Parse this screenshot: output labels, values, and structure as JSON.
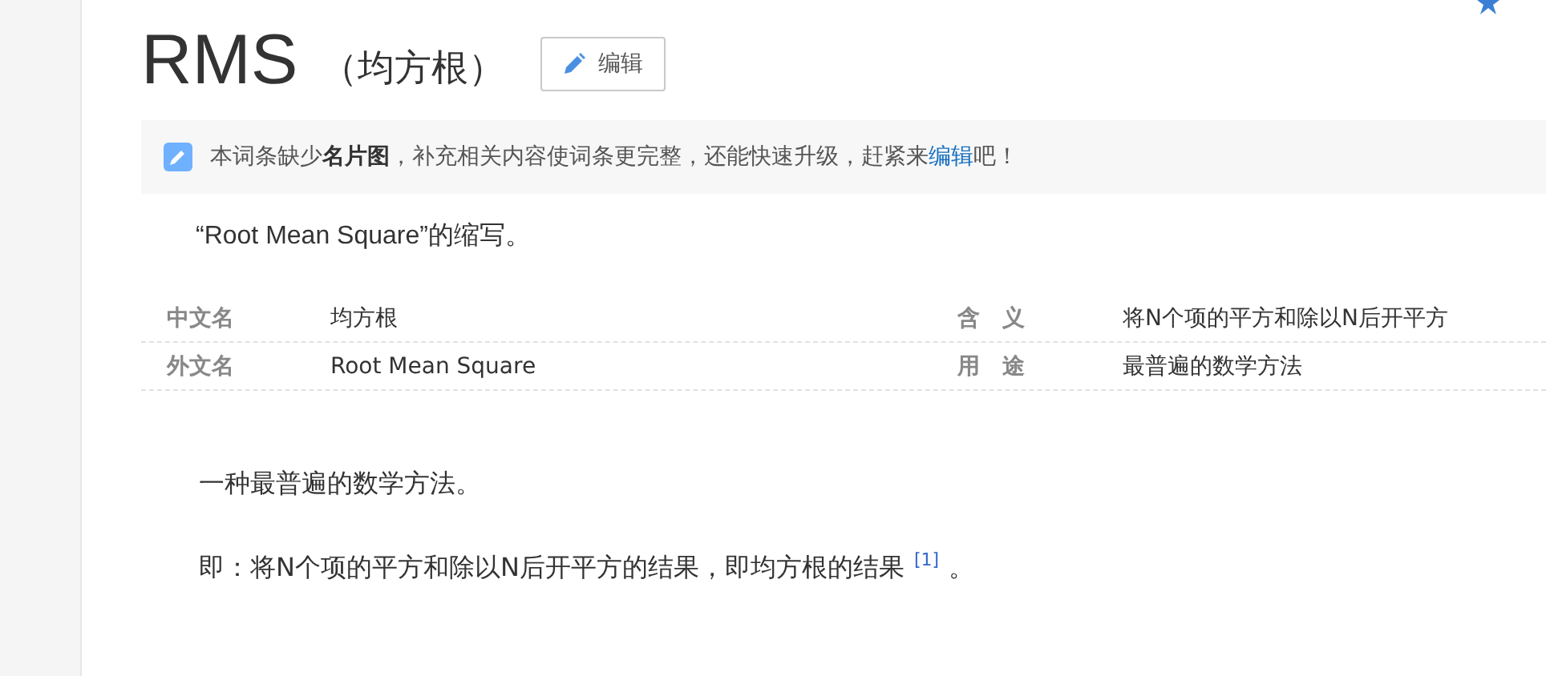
{
  "header": {
    "title": "RMS",
    "subtitle": "（均方根）",
    "edit_button": "编辑"
  },
  "notice": {
    "text": "本词条缺少**名片图**，补充相关内容使词条更完整，还能快速升级，赶紧来",
    "link": "编辑",
    "end": "吧！"
  },
  "summary": "“Root Mean Square”的缩写。",
  "infobox": [
    {
      "left": {
        "label": "中文名",
        "value": "均方根"
      },
      "right": {
        "label": "含　义",
        "value": "将N个项的平方和除以N后开平方"
      }
    },
    {
      "left": {
        "label": "外文名",
        "value": "Root Mean Square"
      },
      "right": {
        "label": "用　途",
        "value": "最普遍的数学方法"
      }
    }
  ],
  "paragraphs": [
    {
      "text": "一种最普遍的数学方法。"
    },
    {
      "text": "即：将N个项的平方和除以N后开平方的结果，即均方根的结果",
      "ref": "[1]",
      "end": "。"
    }
  ]
}
